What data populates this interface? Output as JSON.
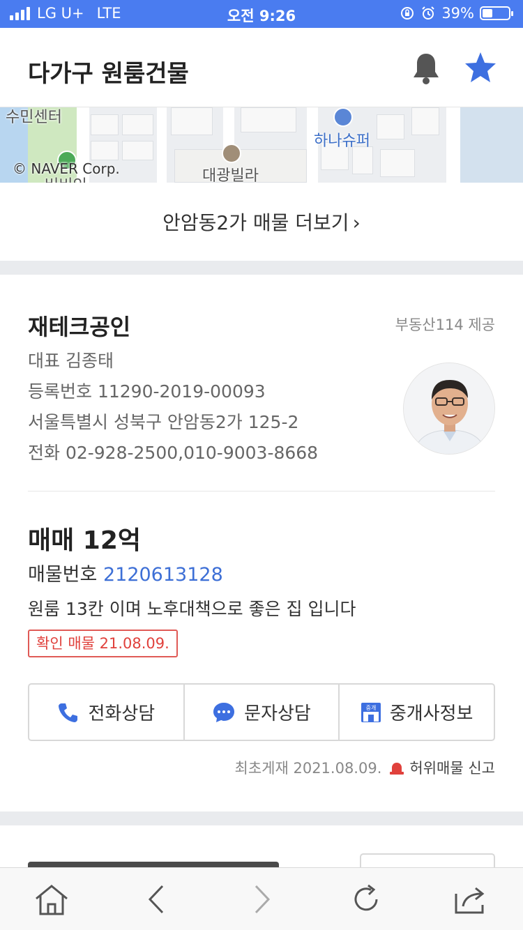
{
  "status_bar": {
    "carrier": "LG U+",
    "network": "LTE",
    "time": "오전 9:26",
    "battery": "39%",
    "battery_level": 0.39
  },
  "header": {
    "title": "다가구 원룸건물",
    "icons": [
      "bell-icon",
      "star-icon"
    ],
    "accent_color": "#4a7cf0"
  },
  "map": {
    "labels": {
      "community_center": "수민센터",
      "store": "하나슈퍼",
      "villa": "대광빌라",
      "cut_label": "버비인"
    },
    "copyright": "© NAVER Corp."
  },
  "more_listings": {
    "label": "안암동2가 매물 더보기",
    "chevron": "›"
  },
  "agent": {
    "name": "재테크공인",
    "provider": "부동산114 제공",
    "representative": "대표 김종태",
    "registration": "등록번호 11290-2019-00093",
    "address": "서울특별시 성북구 안암동2가 125-2",
    "phone": "전화 02-928-2500,010-9003-8668"
  },
  "listing": {
    "price": "매매 12억",
    "number_label": "매물번호",
    "number": "2120613128",
    "description": "원룸 13칸 이며 노후대책으로 좋은 집 입니다",
    "verified": "확인 매물 21.08.09."
  },
  "actions": {
    "call": "전화상담",
    "message": "문자상담",
    "agent_info": "중개사정보",
    "agent_info_icon_text": "중개"
  },
  "posted": {
    "date": "최초게재 2021.08.09.",
    "report": "허위매물 신고"
  },
  "toolbar": {
    "icons": [
      "home-icon",
      "back-icon",
      "forward-icon",
      "reload-icon",
      "share-icon"
    ]
  }
}
